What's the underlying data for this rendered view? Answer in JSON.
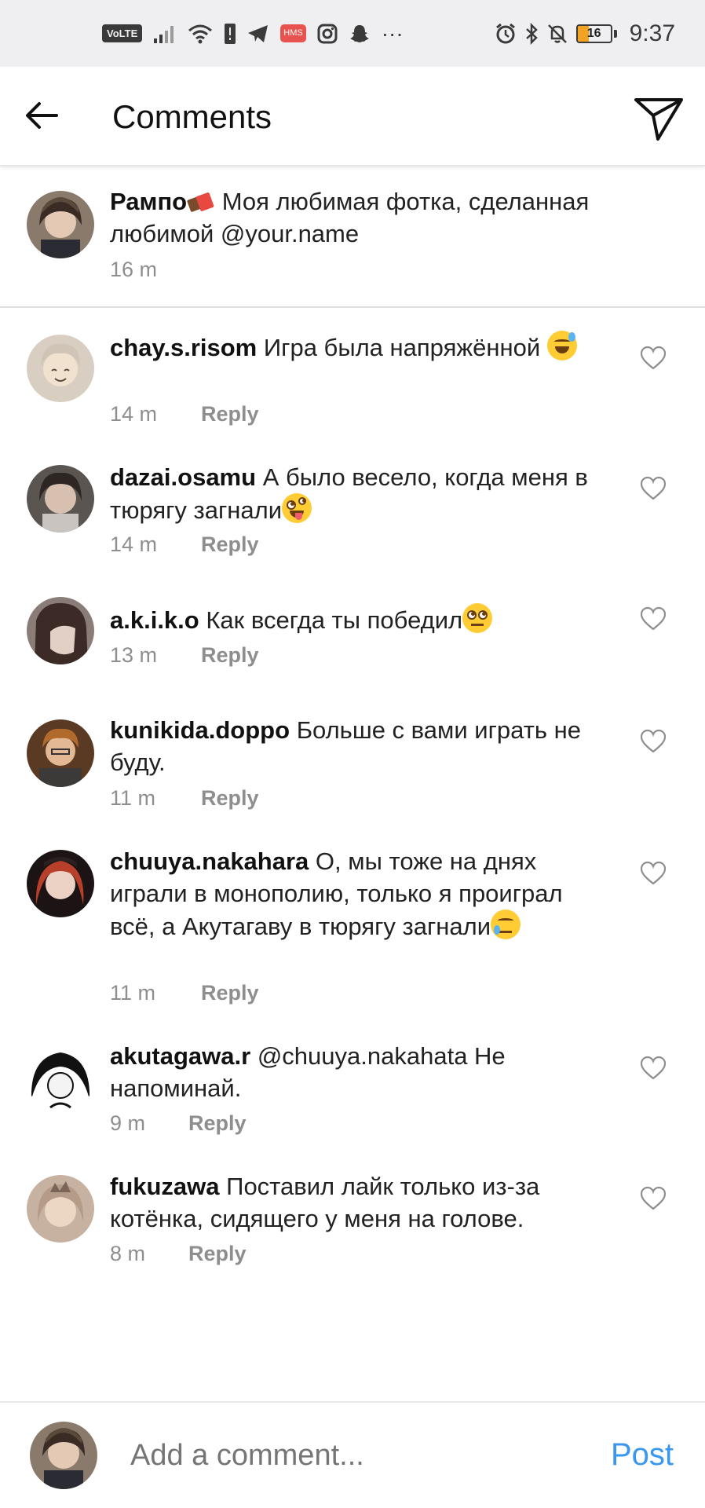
{
  "status_bar": {
    "volte": "VoLTE",
    "hms": "HMS",
    "more": "···",
    "battery_level": "16",
    "time": "9:37"
  },
  "header": {
    "title": "Comments"
  },
  "caption": {
    "username": "Рампо",
    "text": "Моя любимая фотка, сделанная любимой @your.name",
    "time": "16 m"
  },
  "reply_label": "Reply",
  "comments": [
    {
      "username": "chay.s.risom",
      "text": "Игра была напряжённой",
      "emoji": "sweat-smile-emoji",
      "time": "14 m"
    },
    {
      "username": "dazai.osamu",
      "text": "А было весело, когда меня в тюрягу загнали",
      "emoji": "zany-face-emoji",
      "time": "14 m"
    },
    {
      "username": "a.k.i.k.o",
      "text": "Как всегда ты победил",
      "emoji": "eye-roll-emoji",
      "time": "13 m"
    },
    {
      "username": "kunikida.doppo",
      "text": "Больше с вами играть не буду.",
      "time": "11 m"
    },
    {
      "username": "chuuya.nakahara",
      "text": "О, мы тоже на днях играли в монополию, только я проиграл всё, а Акутагаву в тюрягу загнали",
      "emoji": "crying-face-emoji",
      "time": "11 m"
    },
    {
      "username": "akutagawa.r",
      "text": "@chuuya.nakahata Не напоминай.",
      "time": "9 m"
    },
    {
      "username": "fukuzawa",
      "text": "Поставил лайк только из-за котёнка, сидящего у меня на голове.",
      "time": "8 m"
    }
  ],
  "composer": {
    "placeholder": "Add a comment...",
    "post_label": "Post"
  },
  "colors": {
    "accent": "#3897f0",
    "muted": "#8e8e8e",
    "status_bar_bg": "#efeff1"
  }
}
